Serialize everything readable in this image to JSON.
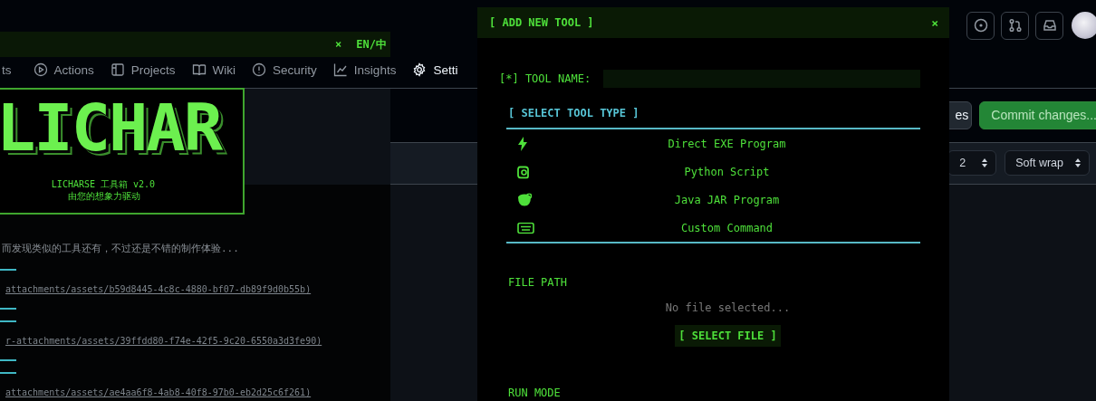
{
  "github": {
    "nav_tabs": [
      "ts",
      "Actions",
      "Projects",
      "Wiki",
      "Security",
      "Insights",
      "Setti"
    ],
    "toolbar_buttons": [
      {
        "kind": "plain",
        "label": "es"
      },
      {
        "kind": "primary",
        "label": "Commit changes..."
      }
    ],
    "indent_select": "2",
    "wrap_select": "Soft wrap",
    "editor_lines": [
      {
        "kind": "text",
        "text": "而发现类似的工具还有，不过还是不错的制作体验..."
      },
      {
        "kind": "rule"
      },
      {
        "kind": "link",
        "text": "attachments/assets/b59d8445-4c8c-4880-bf07-db89f9d0b55b)"
      },
      {
        "kind": "rule"
      },
      {
        "kind": "rule"
      },
      {
        "kind": "link",
        "text": "r-attachments/assets/39ffdd80-f74e-42f5-9c20-6550a3d3fe90)"
      },
      {
        "kind": "rule"
      },
      {
        "kind": "rule"
      },
      {
        "kind": "link",
        "text": "attachments/assets/ae4aa6f8-4ab8-40f8-97b0-eb2d25c6f261)"
      }
    ]
  },
  "left_window": {
    "close": "×",
    "language_toggle": "EN/中",
    "logo": "LICHAR",
    "subtitle": "LICHARSE 工具箱 v2.0",
    "tagline": "由您的想象力驱动"
  },
  "dialog": {
    "title": "[ ADD NEW TOOL ]",
    "close": "×",
    "tool_name_label": "[*] TOOL NAME:",
    "tool_type_heading": "[ SELECT TOOL TYPE ]",
    "tool_types": [
      {
        "kind": "exe",
        "label": "Direct EXE Program"
      },
      {
        "kind": "python",
        "label": "Python Script"
      },
      {
        "kind": "jar",
        "label": "Java JAR Program"
      },
      {
        "kind": "command",
        "label": "Custom Command"
      }
    ],
    "file_path_label": "FILE PATH",
    "file_placeholder": "No file selected...",
    "select_file_button": "[ SELECT FILE ]",
    "run_mode_label": "RUN MODE"
  }
}
